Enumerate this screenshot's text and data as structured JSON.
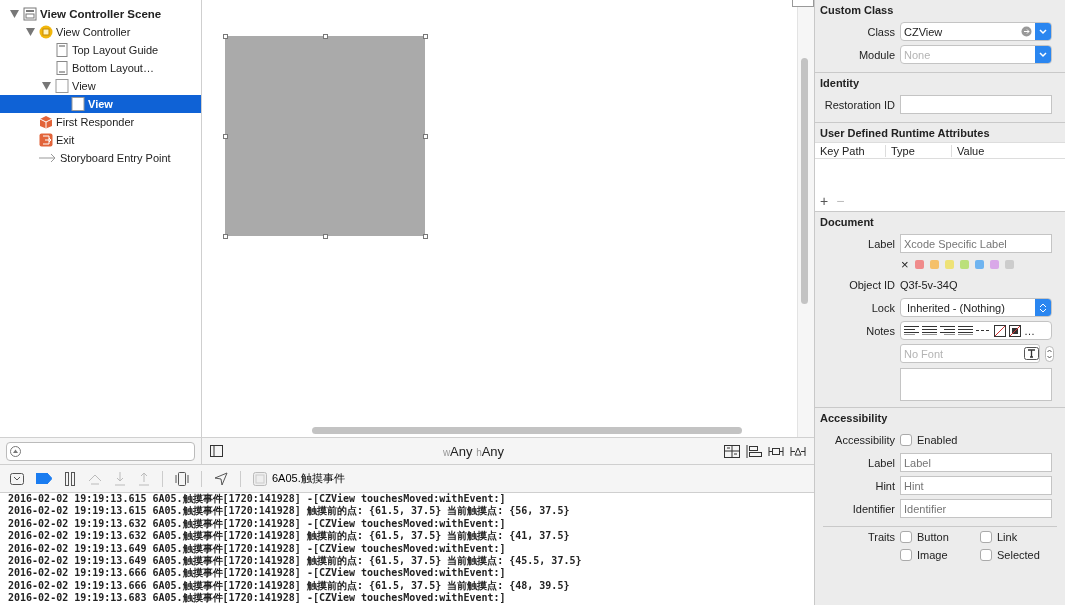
{
  "outline": {
    "items": [
      {
        "label": "View Controller Scene",
        "kind": "scene",
        "expanded": true,
        "selected": false,
        "children": [
          {
            "label": "View Controller",
            "kind": "controller",
            "expanded": true,
            "selected": false,
            "children": [
              {
                "label": "Top Layout Guide",
                "kind": "top-guide",
                "selected": false
              },
              {
                "label": "Bottom Layout…",
                "kind": "bottom-guide",
                "selected": false
              },
              {
                "label": "View",
                "kind": "view",
                "expanded": true,
                "selected": false,
                "children": [
                  {
                    "label": "View",
                    "kind": "view",
                    "selected": true
                  }
                ]
              }
            ]
          },
          {
            "label": "First Responder",
            "kind": "responder",
            "selected": false
          },
          {
            "label": "Exit",
            "kind": "exit",
            "selected": false
          },
          {
            "label": "Storyboard Entry Point",
            "kind": "entry",
            "selected": false
          }
        ]
      }
    ]
  },
  "canvas": {
    "size_class": {
      "w_prefix": "w",
      "w_value": "Any",
      "h_prefix": "h",
      "h_value": "Any"
    }
  },
  "debug_bar": {
    "breakpoints_active": true,
    "target": "6A05.触摸事件"
  },
  "console": {
    "lines": [
      "2016-02-02 19:19:13.615 6A05.触摸事件[1720:141928] -[CZView touchesMoved:withEvent:]",
      "2016-02-02 19:19:13.615 6A05.触摸事件[1720:141928] 触摸前的点: {61.5, 37.5} 当前触摸点: {56, 37.5}",
      "2016-02-02 19:19:13.632 6A05.触摸事件[1720:141928] -[CZView touchesMoved:withEvent:]",
      "2016-02-02 19:19:13.632 6A05.触摸事件[1720:141928] 触摸前的点: {61.5, 37.5} 当前触摸点: {41, 37.5}",
      "2016-02-02 19:19:13.649 6A05.触摸事件[1720:141928] -[CZView touchesMoved:withEvent:]",
      "2016-02-02 19:19:13.649 6A05.触摸事件[1720:141928] 触摸前的点: {61.5, 37.5} 当前触摸点: {45.5, 37.5}",
      "2016-02-02 19:19:13.666 6A05.触摸事件[1720:141928] -[CZView touchesMoved:withEvent:]",
      "2016-02-02 19:19:13.666 6A05.触摸事件[1720:141928] 触摸前的点: {61.5, 37.5} 当前触摸点: {48, 39.5}",
      "2016-02-02 19:19:13.683 6A05.触摸事件[1720:141928] -[CZView touchesMoved:withEvent:]"
    ]
  },
  "inspector": {
    "custom_class": {
      "title": "Custom Class",
      "class_label": "Class",
      "class_value": "CZView",
      "module_label": "Module",
      "module_placeholder": "None"
    },
    "identity": {
      "title": "Identity",
      "restoration_label": "Restoration ID"
    },
    "runtime_attributes": {
      "title": "User Defined Runtime Attributes",
      "columns": [
        "Key Path",
        "Type",
        "Value"
      ],
      "add": "+",
      "remove": "−"
    },
    "document": {
      "title": "Document",
      "label_label": "Label",
      "label_placeholder": "Xcode Specific Label",
      "clear": "×",
      "label_colors": [
        {
          "color": "#f08b8b"
        },
        {
          "color": "#f5c06a"
        },
        {
          "color": "#eee276"
        },
        {
          "color": "#bbe07a"
        },
        {
          "color": "#6fb4f0"
        },
        {
          "color": "#d9a8e8"
        },
        {
          "color": "#cccccc"
        }
      ],
      "object_id_label": "Object ID",
      "object_id": "Q3f-5v-34Q",
      "lock_label": "Lock",
      "lock_value": "Inherited - (Nothing)",
      "notes_label": "Notes",
      "more": "…",
      "font_placeholder": "No Font"
    },
    "accessibility": {
      "title": "Accessibility",
      "accessibility_label": "Accessibility",
      "enabled_label": "Enabled",
      "enabled": false,
      "fields": [
        {
          "label": "Label",
          "placeholder": "Label"
        },
        {
          "label": "Hint",
          "placeholder": "Hint"
        },
        {
          "label": "Identifier",
          "placeholder": "Identifier"
        }
      ],
      "traits_label": "Traits",
      "traits": [
        {
          "label": "Button",
          "checked": false
        },
        {
          "label": "Link",
          "checked": false
        },
        {
          "label": "Image",
          "checked": false
        },
        {
          "label": "Selected",
          "checked": false
        }
      ]
    }
  }
}
